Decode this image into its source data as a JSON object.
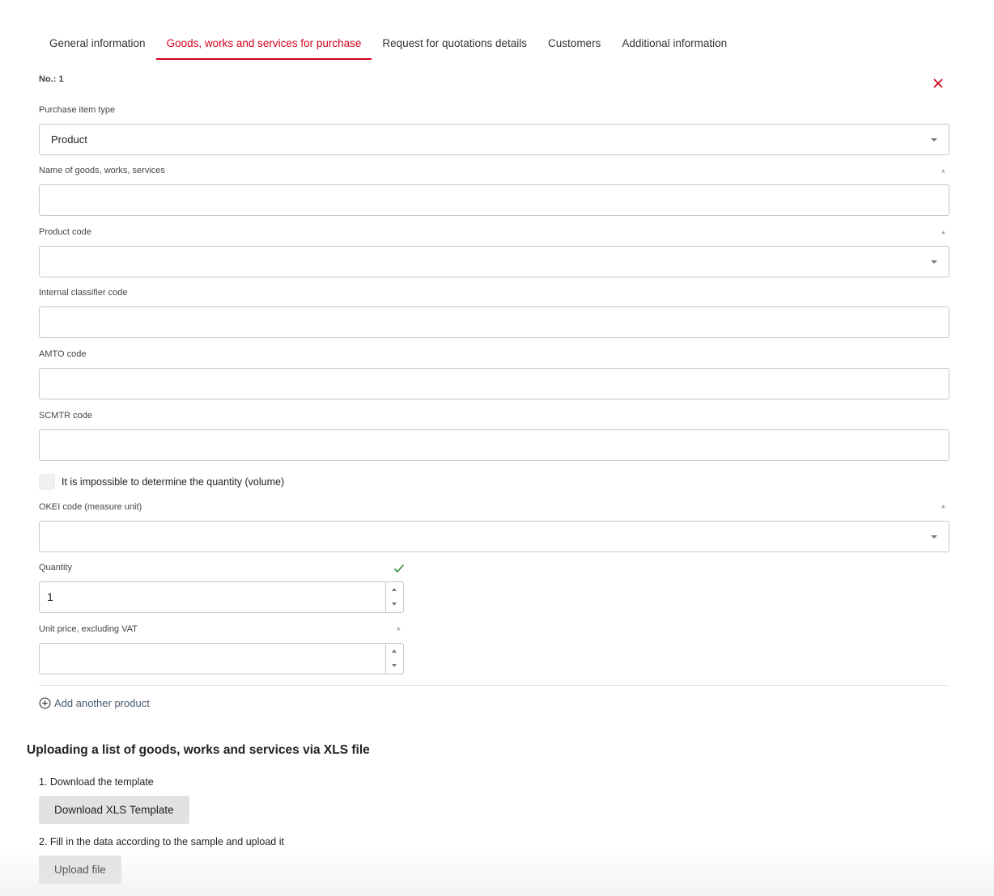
{
  "tabs": [
    {
      "label": "General information"
    },
    {
      "label": "Goods, works and services for purchase"
    },
    {
      "label": "Request for quotations details"
    },
    {
      "label": "Customers"
    },
    {
      "label": "Additional information"
    }
  ],
  "active_tab": "Goods, works and services for purchase",
  "accent_color": "#d0021b",
  "item": {
    "number_label": "No.: 1",
    "close_icon": "close-icon",
    "purchase_item_type": {
      "label": "Purchase item type",
      "value": "Product"
    },
    "name": {
      "label": "Name of goods, works, services",
      "value": "",
      "required": "*"
    },
    "product_code": {
      "label": "Product code",
      "value": "",
      "required": "*"
    },
    "internal_classifier_code": {
      "label": "Internal classifier code",
      "value": ""
    },
    "amto_code": {
      "label": "AMTO code",
      "value": ""
    },
    "scmtr_code": {
      "label": "SCMTR code",
      "value": ""
    },
    "impossible_quantity": {
      "label": "It is impossible to determine the quantity (volume)",
      "checked": false
    },
    "okei_code": {
      "label": "OKEI code (measure unit)",
      "value": "",
      "required": "*"
    },
    "quantity": {
      "label": "Quantity",
      "value": "1",
      "valid_icon": "checkmark-icon"
    },
    "unit_price": {
      "label": "Unit price, excluding VAT",
      "value": "",
      "required": "*"
    }
  },
  "add_product": {
    "label": "Add another product",
    "icon": "plus-circle-icon"
  },
  "upload": {
    "title": "Uploading a list of goods, works and services via XLS file",
    "step1": "1. Download the template",
    "download_button": "Download XLS Template",
    "step2": "2. Fill in the data according to the sample and upload it",
    "upload_button": "Upload file"
  }
}
